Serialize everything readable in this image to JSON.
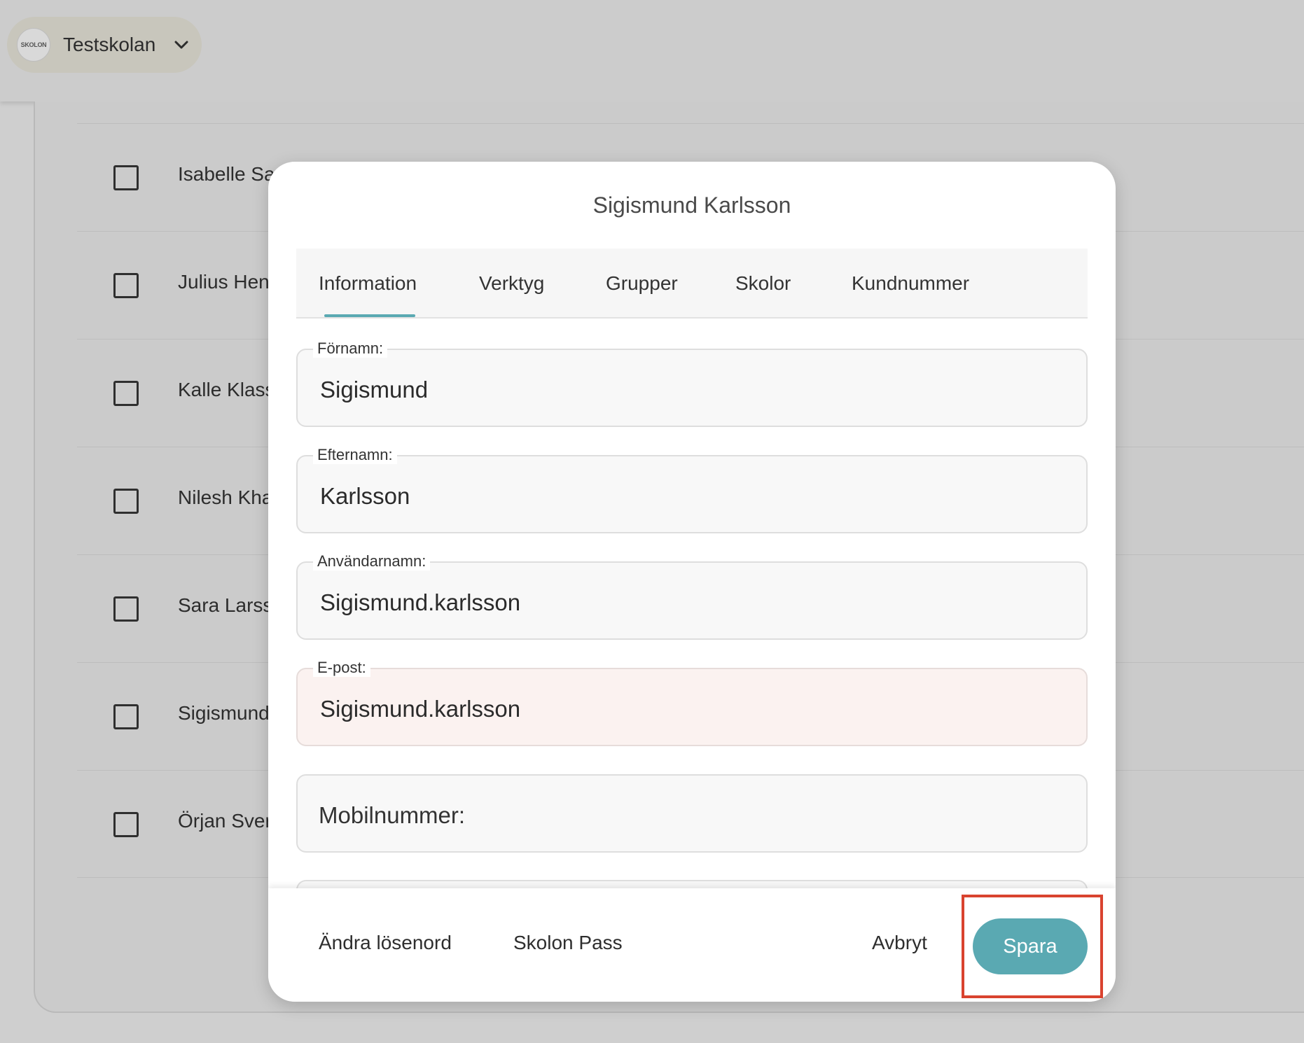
{
  "header": {
    "school_logo_text": "SKOLON",
    "school_name": "Testskolan"
  },
  "list": {
    "rows": [
      {
        "name": "Isabelle Sa"
      },
      {
        "name": "Julius Hen"
      },
      {
        "name": "Kalle Klass"
      },
      {
        "name": "Nilesh Kha"
      },
      {
        "name": "Sara Larss"
      },
      {
        "name": "Sigismund"
      },
      {
        "name": "Örjan Sver"
      }
    ]
  },
  "modal": {
    "title": "Sigismund Karlsson",
    "tabs": [
      {
        "label": "Information",
        "active": true
      },
      {
        "label": "Verktyg"
      },
      {
        "label": "Grupper"
      },
      {
        "label": "Skolor"
      },
      {
        "label": "Kundnummer"
      }
    ],
    "fields": {
      "first_name": {
        "label": "Förnamn:",
        "value": "Sigismund"
      },
      "last_name": {
        "label": "Efternamn:",
        "value": "Karlsson"
      },
      "username": {
        "label": "Användarnamn:",
        "value": "Sigismund.karlsson"
      },
      "email": {
        "label": "E-post:",
        "value": "Sigismund.karlsson"
      },
      "mobile": {
        "placeholder": "Mobilnummer:"
      }
    },
    "footer": {
      "change_password": "Ändra lösenord",
      "skolon_pass": "Skolon Pass",
      "cancel": "Avbryt",
      "save": "Spara"
    }
  },
  "colors": {
    "accent": "#5aa9b2",
    "highlight": "#d9432f",
    "error_field_bg": "#fbf2f0"
  }
}
